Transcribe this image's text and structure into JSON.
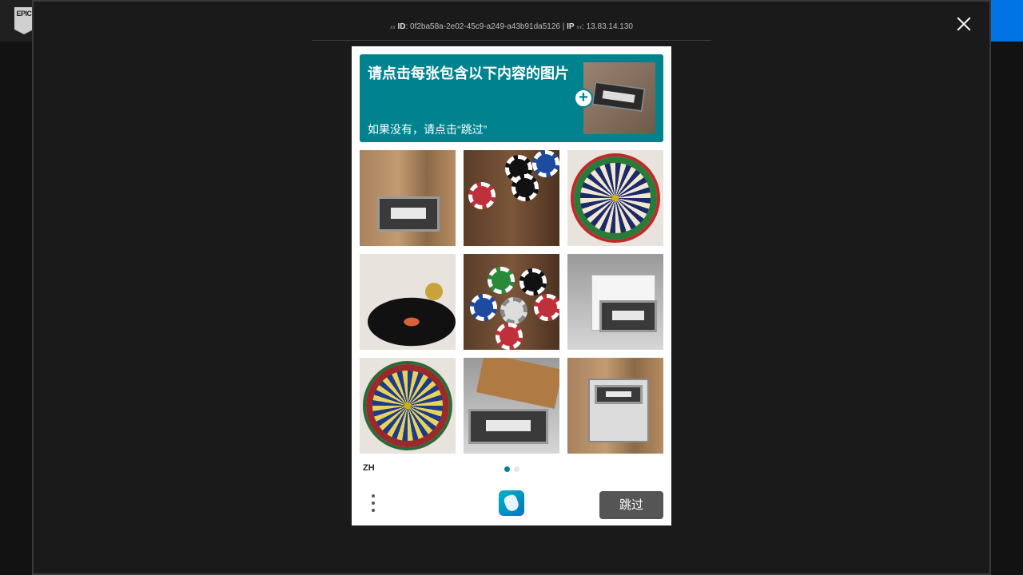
{
  "background": {
    "logo_text": "EPIC"
  },
  "modal": {
    "id_line": {
      "id_prefix": "𝑥𝑥",
      "id_label": "ID",
      "id_value": ": 0f2ba58a-2e02-45c9-a249-a43b91da5126 | ",
      "ip_label": "IP",
      "ip_prefix": "𝑥𝑥",
      "ip_value": ": 13.83.14.130"
    }
  },
  "captcha": {
    "prompt_title": "请点击每张包含以下内容的图片",
    "prompt_subtitle": "如果没有，请点击“跳过”",
    "language": "ZH",
    "skip_label": "跳过",
    "page_count": 2,
    "active_page": 1,
    "grid": [
      {
        "name": "cassette-wood"
      },
      {
        "name": "poker-chips-stack"
      },
      {
        "name": "dartboard-green"
      },
      {
        "name": "vinyl-record"
      },
      {
        "name": "poker-chips-spread"
      },
      {
        "name": "cassette-white-box"
      },
      {
        "name": "dartboard-blue"
      },
      {
        "name": "cassettes-tray"
      },
      {
        "name": "cassette-player"
      }
    ]
  }
}
